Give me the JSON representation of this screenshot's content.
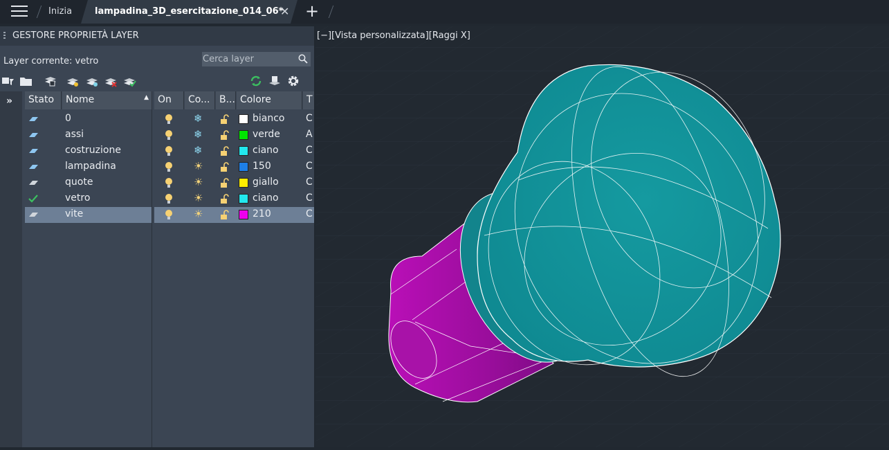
{
  "tabs": {
    "home": "Inizia",
    "active": "lampadina_3D_esercitazione_014_06*"
  },
  "palette": {
    "title": "GESTORE PROPRIETÀ LAYER",
    "current_layer": "Layer corrente: vetro",
    "search_placeholder": "Cerca layer",
    "columns_left": [
      "Stato",
      "Nome"
    ],
    "columns_right": [
      "On",
      "Co...",
      "B...",
      "Colore",
      "T"
    ],
    "layers": [
      {
        "name": "0",
        "color_name": "bianco",
        "color": "#ffffff",
        "type_initial": "C",
        "frozen_glyph": "❄",
        "state": "layer"
      },
      {
        "name": "assi",
        "color_name": "verde",
        "color": "#00e600",
        "type_initial": "A",
        "frozen_glyph": "❄",
        "state": "layer"
      },
      {
        "name": "costruzione",
        "color_name": "ciano",
        "color": "#22e8ee",
        "type_initial": "C",
        "frozen_glyph": "❄",
        "state": "layer"
      },
      {
        "name": "lampadina",
        "color_name": "150",
        "color": "#1e7fe6",
        "type_initial": "C",
        "frozen_glyph": "☀",
        "state": "layer"
      },
      {
        "name": "quote",
        "color_name": "giallo",
        "color": "#ffee00",
        "type_initial": "C",
        "frozen_glyph": "☀",
        "state": "layer-dim"
      },
      {
        "name": "vetro",
        "color_name": "ciano",
        "color": "#22e8ee",
        "type_initial": "C",
        "frozen_glyph": "☀",
        "state": "current"
      },
      {
        "name": "vite",
        "color_name": "210",
        "color": "#ee00ee",
        "type_initial": "C",
        "frozen_glyph": "☀",
        "state": "layer-dim"
      }
    ],
    "selected_index": 6
  },
  "viewport": {
    "label": "[−][Vista personalizzata][Raggi X]"
  }
}
